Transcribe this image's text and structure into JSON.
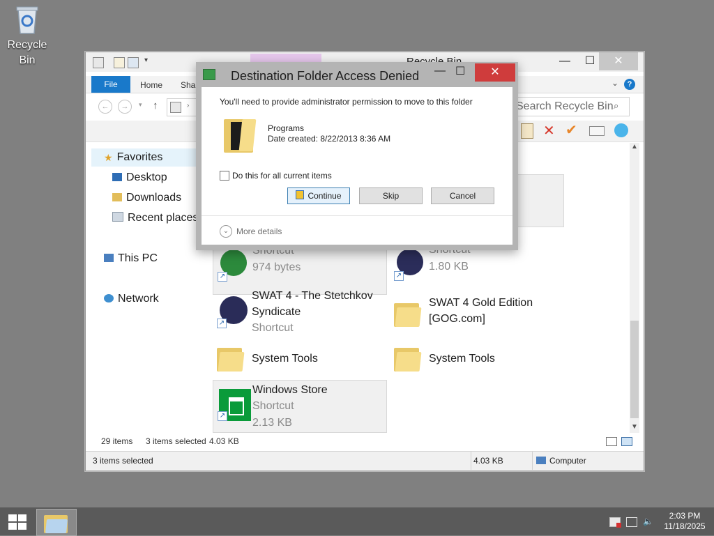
{
  "desktop": {
    "recycle_bin_label": "Recycle\nBin"
  },
  "explorer": {
    "title": "Recycle Bin",
    "tabs": {
      "file": "File",
      "home": "Home",
      "share": "Share"
    },
    "search_placeholder": "Search Recycle Bin",
    "nav": {
      "favorites": "Favorites",
      "desktop": "Desktop",
      "downloads": "Downloads",
      "recent": "Recent places",
      "this_pc": "This PC",
      "network": "Network"
    },
    "files": [
      {
        "name": "Shortcut",
        "size": "974 bytes"
      },
      {
        "name": "Shortcut",
        "size": "1.80 KB"
      },
      {
        "name": "SWAT 4 - The Stetchkov Syndicate",
        "sub": "Shortcut"
      },
      {
        "name": "SWAT 4 Gold Edition [GOG.com]"
      },
      {
        "name": "System Tools"
      },
      {
        "name": "System Tools"
      },
      {
        "name": "Windows Store",
        "sub": "Shortcut",
        "size": "2.13 KB"
      }
    ],
    "status": {
      "items": "29 items",
      "selected": "3 items selected",
      "selected_size": "4.03 KB",
      "bottom_selected": "3 items selected",
      "bottom_size": "4.03 KB",
      "location": "Computer"
    }
  },
  "dialog": {
    "title": "Destination Folder Access Denied",
    "message": "You'll need to provide administrator permission to move to this folder",
    "folder_name": "Programs",
    "date_created": "Date created: 8/22/2013 8:36 AM",
    "checkbox_label": "Do this for all current items",
    "continue_label": "Continue",
    "skip_label": "Skip",
    "cancel_label": "Cancel",
    "more_details_label": "More details"
  },
  "taskbar": {
    "time": "2:03 PM",
    "date": "11/18/2025"
  },
  "colors": {
    "accent": "#1979ca",
    "close_red": "#cf3c3c",
    "folder": "#f6dd8a"
  }
}
